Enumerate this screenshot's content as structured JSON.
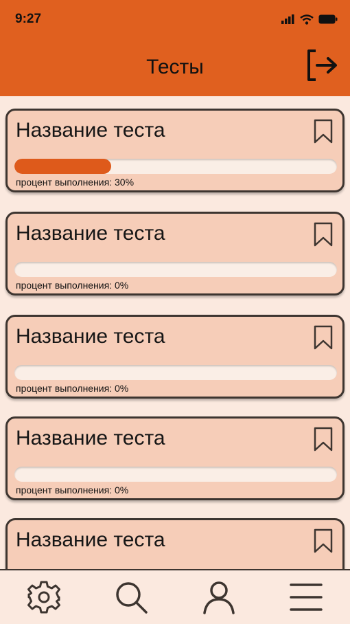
{
  "status_bar": {
    "time": "9:27"
  },
  "header": {
    "title": "Тесты"
  },
  "tests": [
    {
      "title": "Название теста",
      "progress_label": "процент выполнения: 30%",
      "progress": 0.3
    },
    {
      "title": "Название теста",
      "progress_label": "процент выполнения: 0%",
      "progress": 0
    },
    {
      "title": "Название теста",
      "progress_label": "процент выполнения: 0%",
      "progress": 0
    },
    {
      "title": "Название теста",
      "progress_label": "процент выполнения: 0%",
      "progress": 0
    },
    {
      "title": "Название теста"
    }
  ],
  "nav": [
    "settings-icon",
    "search-icon",
    "profile-icon",
    "menu-icon"
  ],
  "colors": {
    "accent": "#e0601f",
    "card": "#f6cdb8",
    "background": "#fbe9df",
    "progress": "#de5a1b"
  }
}
